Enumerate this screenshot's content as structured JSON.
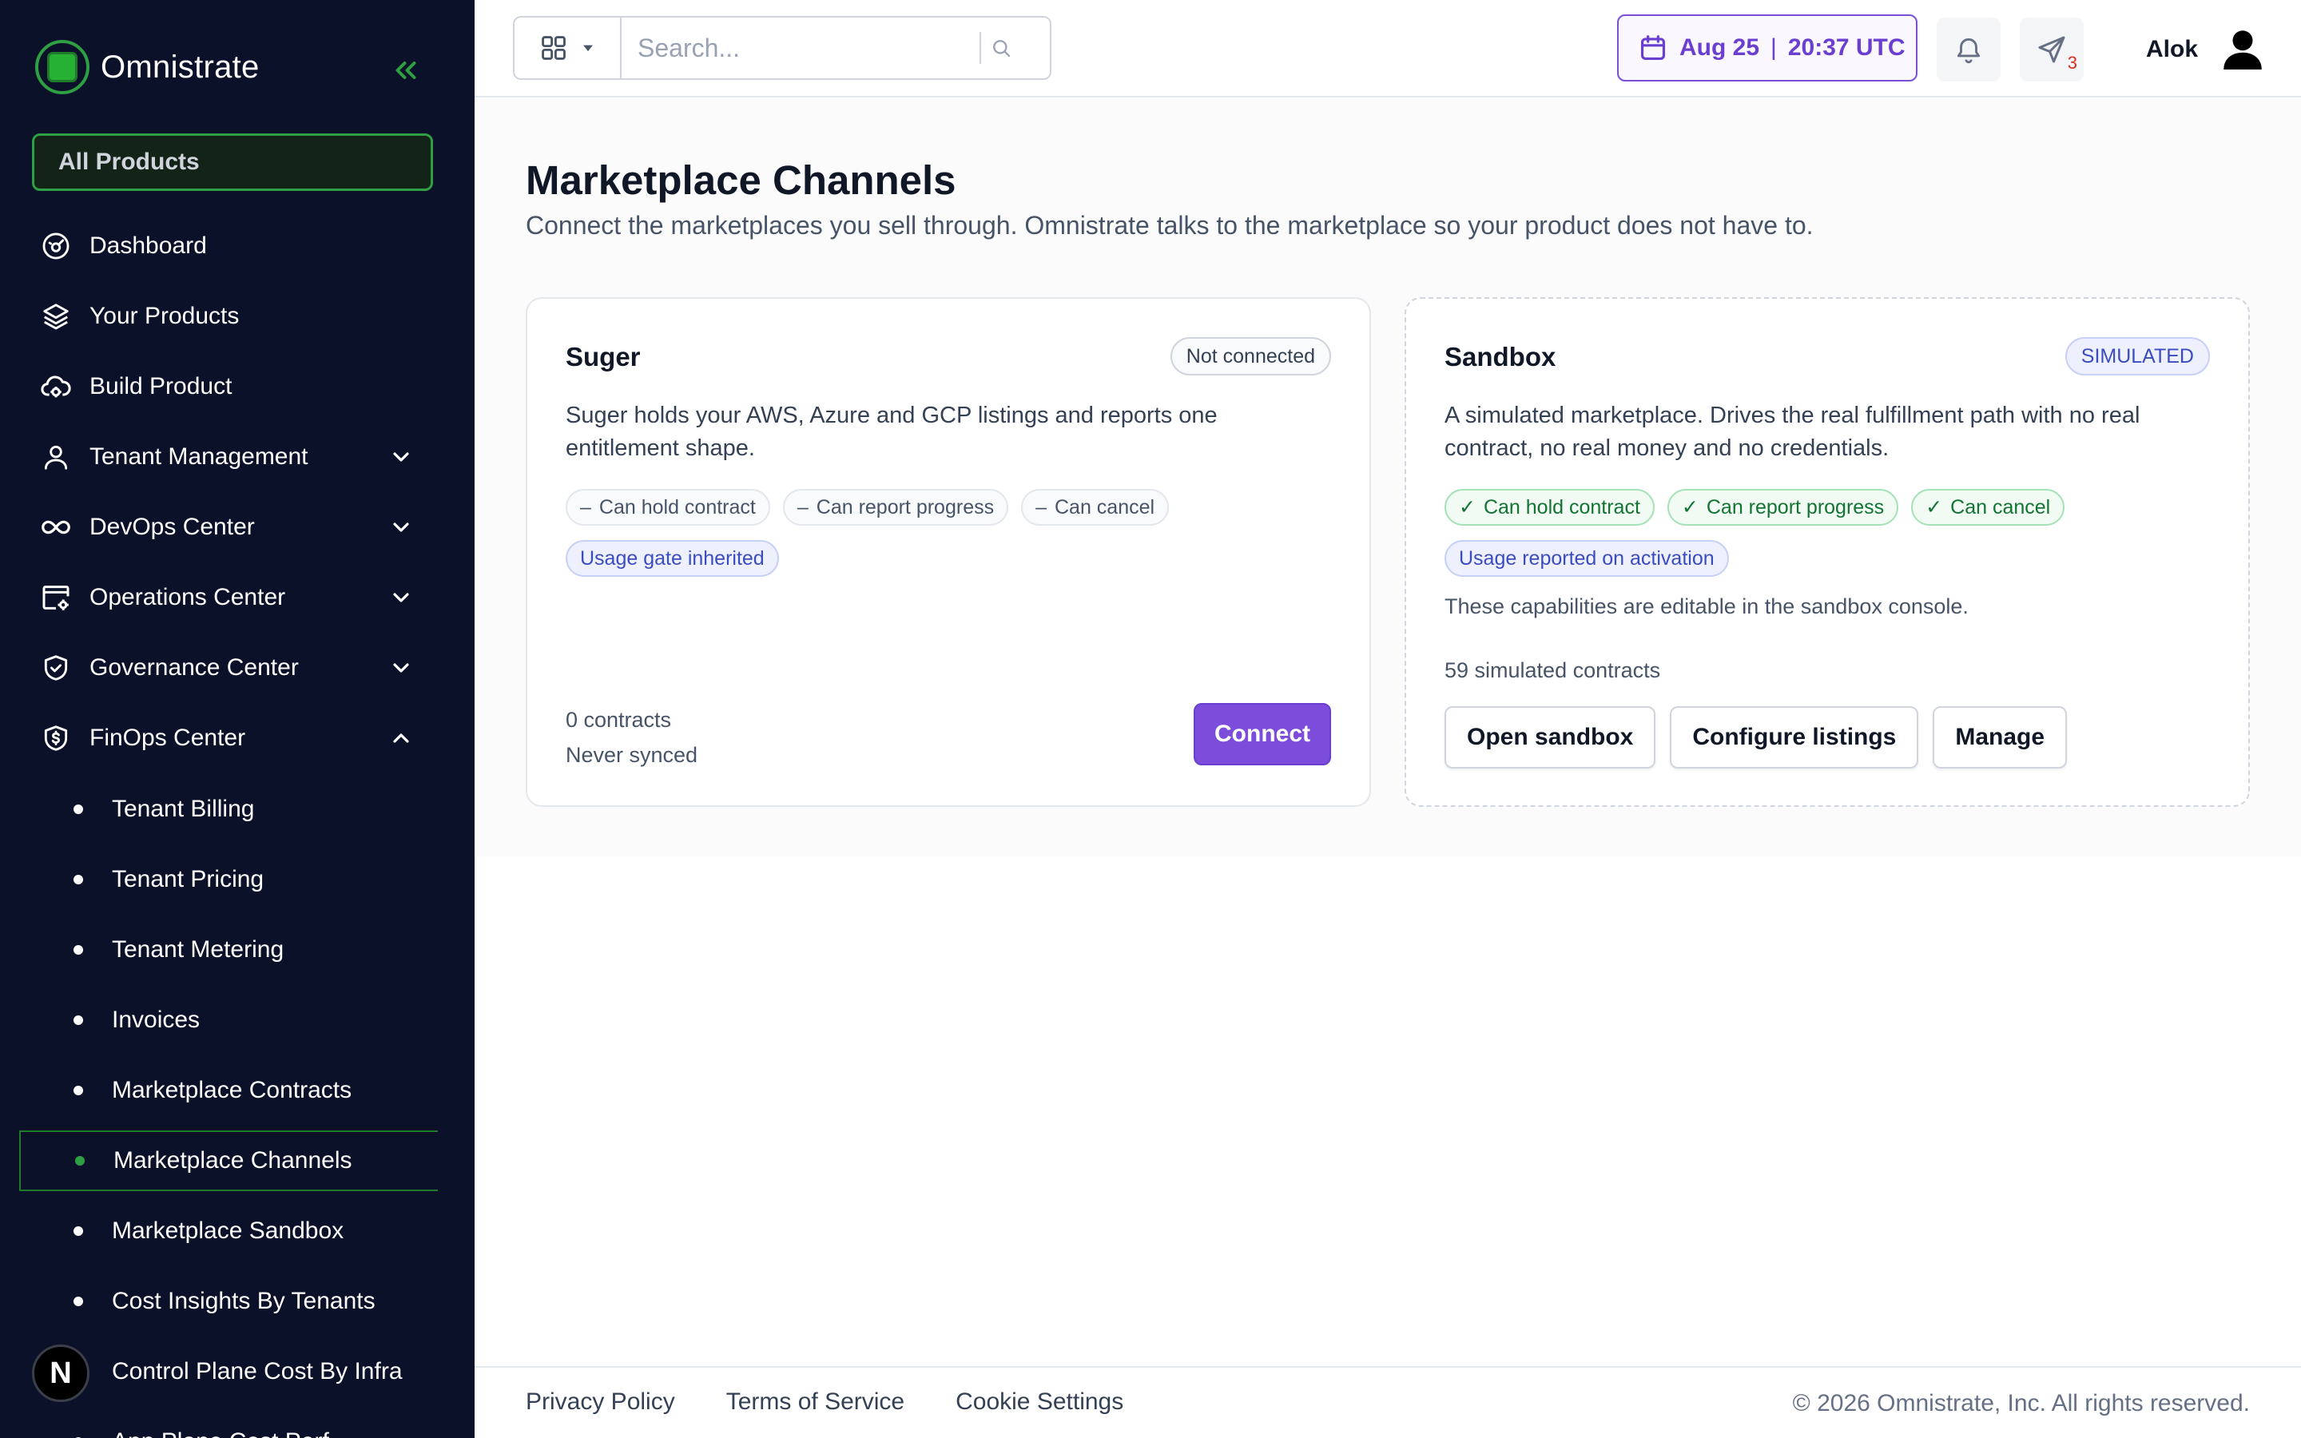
{
  "brand": {
    "name": "Omnistrate"
  },
  "sidebar": {
    "all_products": "All Products",
    "items": [
      {
        "label": "Dashboard",
        "icon": "dashboard-gauge-icon"
      },
      {
        "label": "Your Products",
        "icon": "layers-icon"
      },
      {
        "label": "Build Product",
        "icon": "cloud-gear-icon"
      },
      {
        "label": "Tenant Management",
        "icon": "user-icon",
        "expandable": true
      },
      {
        "label": "DevOps Center",
        "icon": "infinity-icon",
        "expandable": true
      },
      {
        "label": "Operations Center",
        "icon": "window-gear-icon",
        "expandable": true
      },
      {
        "label": "Governance Center",
        "icon": "shield-check-icon",
        "expandable": true
      },
      {
        "label": "FinOps Center",
        "icon": "shield-dollar-icon",
        "expanded": true
      }
    ],
    "finops_subitems": [
      "Tenant Billing",
      "Tenant Pricing",
      "Tenant Metering",
      "Invoices",
      "Marketplace Contracts",
      "Marketplace Channels",
      "Marketplace Sandbox",
      "Cost Insights By Tenants",
      "Control Plane Cost By Infra",
      "App Plane Cost Perf..."
    ],
    "active_subitem": "Marketplace Channels",
    "n_badge": "N"
  },
  "topbar": {
    "search_placeholder": "Search...",
    "date": "Aug 25",
    "date_separator": "|",
    "time": "20:37 UTC",
    "notification_count": "3",
    "user_name": "Alok"
  },
  "page": {
    "title": "Marketplace Channels",
    "subtitle": "Connect the marketplaces you sell through. Omnistrate talks to the marketplace so your product does not have to."
  },
  "cards": {
    "suger": {
      "title": "Suger",
      "status": "Not connected",
      "description": "Suger holds your AWS, Azure and GCP listings and reports one entitlement shape.",
      "capabilities": [
        "Can hold contract",
        "Can report progress",
        "Can cancel"
      ],
      "capability_marker": "–",
      "usage_chip": "Usage gate inherited",
      "contracts": "0 contracts",
      "sync": "Never synced",
      "connect_label": "Connect"
    },
    "sandbox": {
      "title": "Sandbox",
      "status": "SIMULATED",
      "description": "A simulated marketplace. Drives the real fulfillment path with no real contract, no real money and no credentials.",
      "capabilities": [
        "Can hold contract",
        "Can report progress",
        "Can cancel"
      ],
      "capability_marker": "✓",
      "usage_chip": "Usage reported on activation",
      "note": "These capabilities are editable in the sandbox console.",
      "contracts": "59 simulated contracts",
      "buttons": [
        "Open sandbox",
        "Configure listings",
        "Manage"
      ]
    }
  },
  "footer": {
    "links": [
      "Privacy Policy",
      "Terms of Service",
      "Cookie Settings"
    ],
    "copyright": "© 2026 Omnistrate, Inc. All rights reserved."
  },
  "colors": {
    "sidebar_bg": "#0a1128",
    "brand_green": "#2ea043",
    "accent_purple": "#7c4ddb",
    "success_green": "#137333",
    "info_blue": "#3b4cc0"
  }
}
